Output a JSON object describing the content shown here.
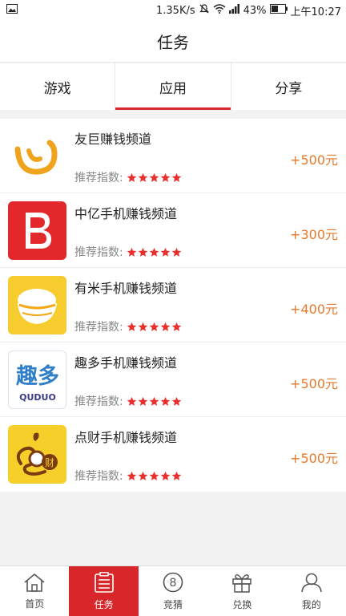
{
  "status_bar": {
    "speed": "1.35K/s",
    "battery": "43%",
    "time": "上午10:27"
  },
  "header": {
    "title": "任务"
  },
  "tabs": [
    {
      "label": "游戏"
    },
    {
      "label": "应用"
    },
    {
      "label": "分享"
    }
  ],
  "rating_label": "推荐指数:",
  "items": [
    {
      "name": "友巨赚钱频道",
      "reward": "+500元",
      "rating": 5,
      "icon": "youju-logo-icon"
    },
    {
      "name": "中亿手机赚钱频道",
      "reward": "+300元",
      "rating": 5,
      "icon": "zhongyi-b-logo-icon"
    },
    {
      "name": "有米手机赚钱频道",
      "reward": "+400元",
      "rating": 5,
      "icon": "youmi-rice-bowl-icon"
    },
    {
      "name": "趣多手机赚钱频道",
      "reward": "+500元",
      "rating": 5,
      "icon": "quduo-logo-icon",
      "icon_text": {
        "cn": "趣多",
        "en": "QUDUO"
      }
    },
    {
      "name": "点财手机赚钱频道",
      "reward": "+500元",
      "rating": 5,
      "icon": "diancai-logo-icon",
      "icon_text": {
        "badge": "财"
      }
    }
  ],
  "nav": [
    {
      "label": "首页",
      "icon": "home-icon"
    },
    {
      "label": "任务",
      "icon": "task-list-icon"
    },
    {
      "label": "竞猜",
      "icon": "guess-8-icon",
      "icon_text": "8"
    },
    {
      "label": "兑换",
      "icon": "gift-icon"
    },
    {
      "label": "我的",
      "icon": "user-icon"
    }
  ],
  "colors": {
    "accent": "#d8272b",
    "reward": "#e6792a",
    "star": "#e8312f"
  }
}
